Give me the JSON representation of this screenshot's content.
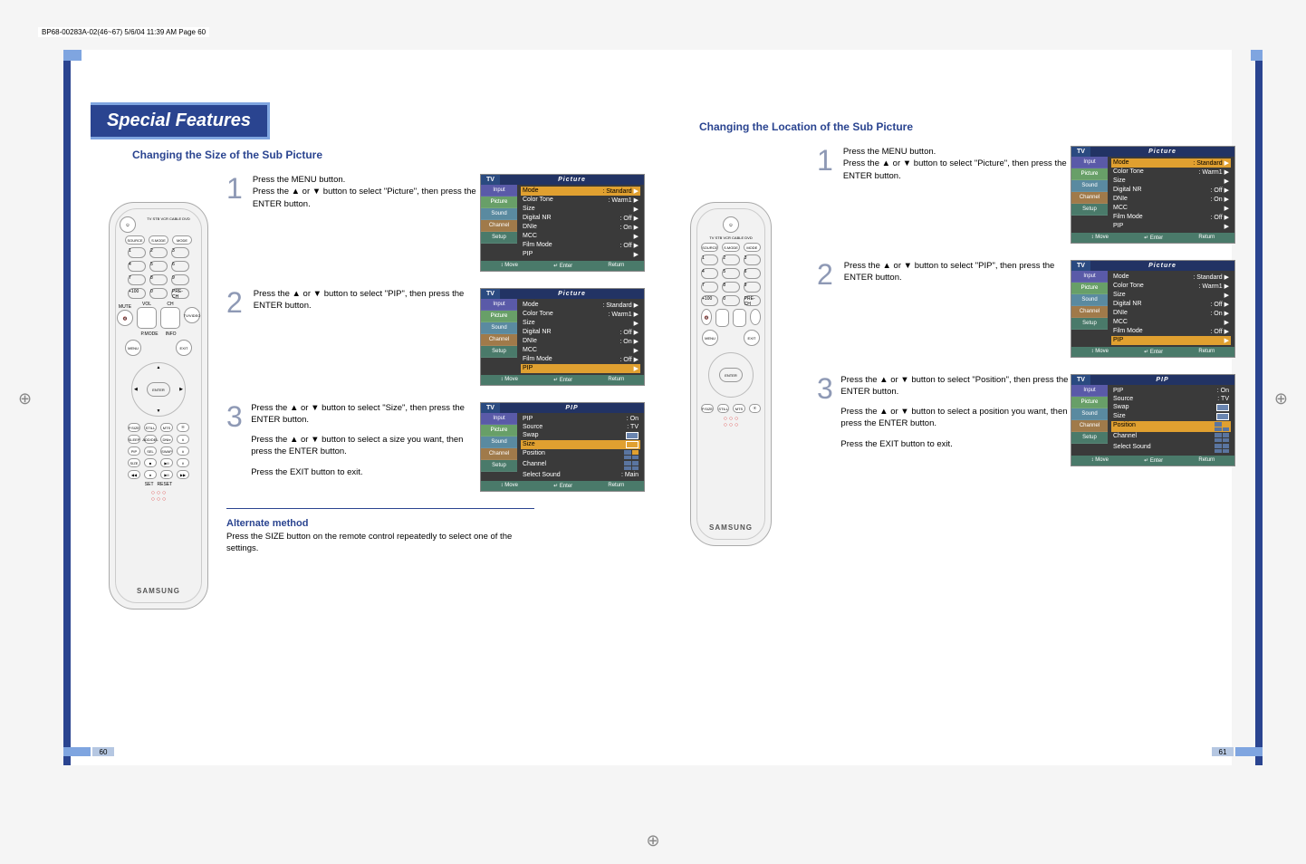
{
  "print_header": "BP68-00283A-02(46~67)  5/6/04  11:39 AM  Page 60",
  "chapter": "Special Features",
  "left": {
    "section_title": "Changing the Size of the Sub Picture",
    "steps": {
      "s1": "Press the MENU button.\nPress the ▲ or ▼ button to select \"Picture\", then press the ENTER button.",
      "s2": "Press the ▲ or ▼ button to select \"PIP\", then press the ENTER button.",
      "s3a": "Press the ▲ or ▼ button to select \"Size\", then press the ENTER button.",
      "s3b": "Press the ▲ or ▼ button to select a size you want, then press the ENTER button.",
      "s3c": "Press the EXIT button to exit."
    },
    "alt_title": "Alternate method",
    "alt_text": "Press the SIZE button on the remote control repeatedly to select one of the settings.",
    "page_num": "60"
  },
  "right": {
    "section_title": "Changing the Location of the Sub Picture",
    "steps": {
      "s1": "Press the MENU button.\nPress the ▲ or ▼ button to select \"Picture\", then press the ENTER button.",
      "s2": "Press the ▲ or ▼ button to select \"PIP\", then press the ENTER button.",
      "s3a": "Press the ▲ or ▼ button to select \"Position\", then press the ENTER button.",
      "s3b": "Press the ▲ or ▼ button to select a position you want, then press the ENTER button.",
      "s3c": "Press the EXIT button to exit."
    },
    "page_num": "61"
  },
  "osd": {
    "tv": "TV",
    "picture_title": "Picture",
    "pip_title": "PIP",
    "tabs": {
      "input": "Input",
      "picture": "Picture",
      "sound": "Sound",
      "channel": "Channel",
      "setup": "Setup"
    },
    "items_picture": {
      "mode": {
        "label": "Mode",
        "value": ": Standard"
      },
      "colortone": {
        "label": "Color Tone",
        "value": ": Warm1"
      },
      "size": {
        "label": "Size",
        "value": ""
      },
      "dnr": {
        "label": "Digital NR",
        "value": ": Off"
      },
      "dnie": {
        "label": "DNIe",
        "value": ": On"
      },
      "mcc": {
        "label": "MCC",
        "value": ""
      },
      "film": {
        "label": "Film Mode",
        "value": ": Off"
      },
      "pip": {
        "label": "PIP",
        "value": ""
      }
    },
    "items_pip_size": {
      "pip": {
        "label": "PIP",
        "value": ": On"
      },
      "source": {
        "label": "Source",
        "value": ": TV"
      },
      "swap": {
        "label": "Swap",
        "value": ""
      },
      "size": {
        "label": "Size",
        "value": ""
      },
      "position": {
        "label": "Position",
        "value": ""
      },
      "channel": {
        "label": "Channel",
        "value": ""
      },
      "selsound": {
        "label": "Select Sound",
        "value": ": Main"
      }
    },
    "items_pip_pos": {
      "pip": {
        "label": "PIP",
        "value": ": On"
      },
      "source": {
        "label": "Source",
        "value": ": TV"
      },
      "swap": {
        "label": "Swap",
        "value": ""
      },
      "size": {
        "label": "Size",
        "value": ""
      },
      "position": {
        "label": "Position",
        "value": ""
      },
      "channel": {
        "label": "Channel",
        "value": ""
      },
      "selsound": {
        "label": "Select Sound",
        "value": ""
      }
    },
    "footer": {
      "move": "Move",
      "enter": "Enter",
      "return": "Return"
    }
  },
  "remote": {
    "logo": "SAMSUNG",
    "labels": {
      "power": "POWER",
      "tv": "TV",
      "stb": "STB",
      "vcr": "VCR",
      "cable": "CABLE",
      "dvd": "DVD",
      "source": "SOURCE",
      "smode": "S.MODE",
      "mode": "MODE",
      "plus100": "+100",
      "zero": "0",
      "prech": "PRE-CH",
      "mute": "MUTE",
      "vol": "VOL",
      "ch": "CH",
      "tvvideo": "TV/VIDEO",
      "pmode": "P.MODE",
      "info": "INFO",
      "menu": "MENU",
      "exit": "EXIT",
      "enter": "ENTER",
      "psize": "P.SIZE",
      "still": "STILL",
      "mts": "MTS",
      "srs": "SRS",
      "sleep": "SLEEP",
      "addel": "ADD/DEL",
      "dnie": "DNIe",
      "pip": "PIP",
      "sel": "SEL",
      "swap": "SWAP",
      "chctrl": "CH",
      "size": "SIZE",
      "stop": "STOP",
      "playpause": "PLAY/PAUSE",
      "fav": "CH",
      "set": "SET",
      "reset": "RESET"
    }
  }
}
